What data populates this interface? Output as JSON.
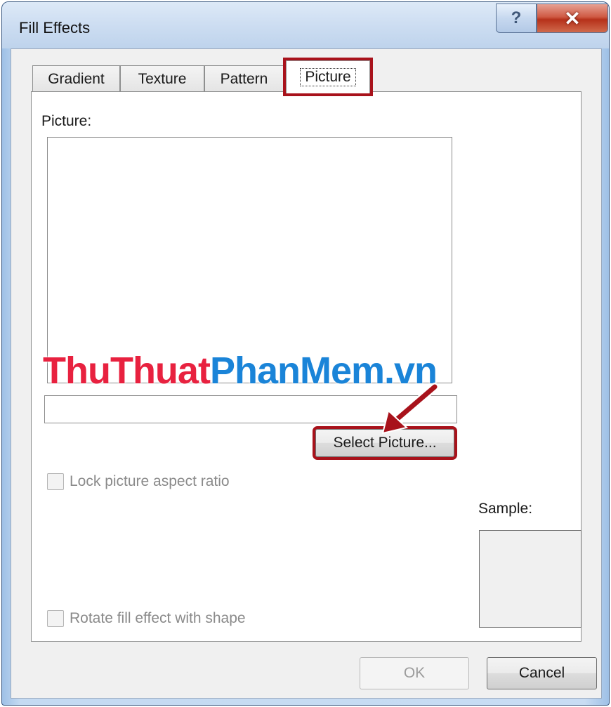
{
  "window": {
    "title": "Fill Effects",
    "help_glyph": "?",
    "close_glyph": "✕"
  },
  "tabs": [
    {
      "label": "Gradient",
      "active": false
    },
    {
      "label": "Texture",
      "active": false
    },
    {
      "label": "Pattern",
      "active": false
    },
    {
      "label": "Picture",
      "active": true
    }
  ],
  "picture_panel": {
    "picture_label": "Picture:",
    "filename_value": "",
    "select_button_label": "Select Picture...",
    "lock_aspect_label": "Lock picture aspect ratio",
    "lock_aspect_checked": false,
    "rotate_label": "Rotate fill effect with shape",
    "rotate_checked": false,
    "sample_label": "Sample:"
  },
  "watermark": {
    "part1": "ThuThuat",
    "part2": "PhanMem.vn"
  },
  "footer": {
    "ok_label": "OK",
    "cancel_label": "Cancel"
  },
  "colors": {
    "highlight": "#a8121b",
    "watermark_red": "#e8213f",
    "watermark_blue": "#1a84d8"
  }
}
